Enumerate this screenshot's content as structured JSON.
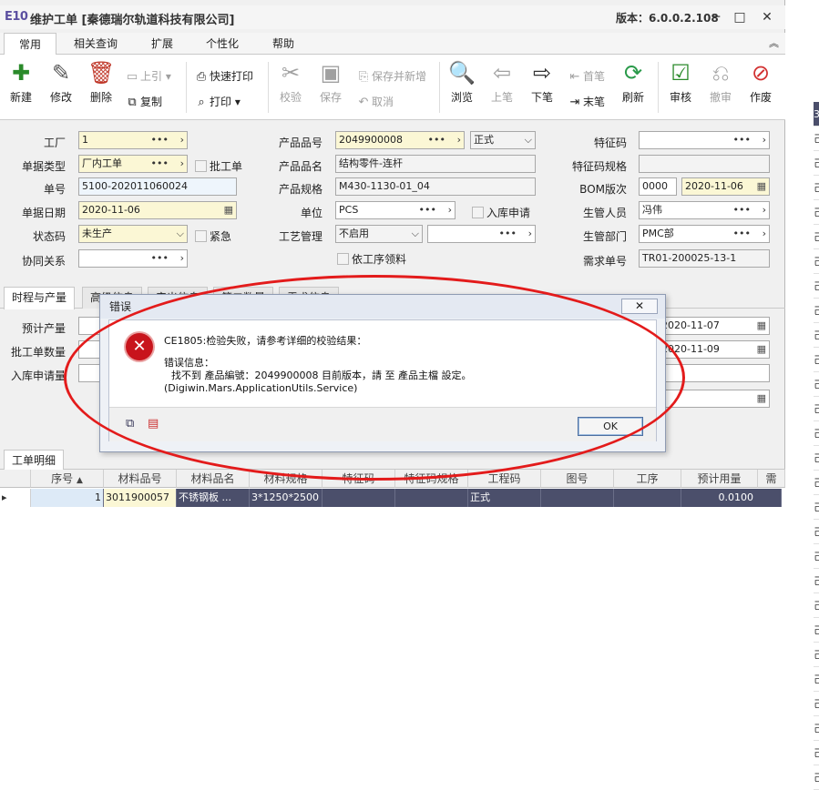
{
  "title": {
    "logo": "E10",
    "doc": "维护工单 [秦德瑞尔轨道科技有限公司]",
    "version": "版本：6.0.0.2.108"
  },
  "menu": [
    "常用",
    "相关查询",
    "扩展",
    "个性化",
    "帮助"
  ],
  "toolbar": {
    "new": "新建",
    "edit": "修改",
    "delete": "删除",
    "prev_rec": "上引",
    "copy": "复制",
    "quick_print": "快速打印",
    "print": "打印",
    "check": "校验",
    "save": "保存",
    "save_new": "保存并新增",
    "cancel": "取消",
    "browse": "浏览",
    "prev": "上笔",
    "next": "下笔",
    "first": "首笔",
    "last": "末笔",
    "refresh": "刷新",
    "audit": "审核",
    "unaudit": "撤审",
    "void": "作废"
  },
  "form": {
    "factory": {
      "label": "工厂",
      "value": "1"
    },
    "doc_type": {
      "label": "单据类型",
      "value": "厂内工单"
    },
    "batch": {
      "label": "批工单"
    },
    "doc_no": {
      "label": "单号",
      "value": "5100-202011060024"
    },
    "doc_date": {
      "label": "单据日期",
      "value": "2020-11-06"
    },
    "status": {
      "label": "状态码",
      "value": "未生产"
    },
    "urgent": {
      "label": "紧急"
    },
    "collab": {
      "label": "协同关系",
      "value": ""
    },
    "item_no": {
      "label": "产品品号",
      "value": "2049900008",
      "status": "正式"
    },
    "item_name": {
      "label": "产品品名",
      "value": "结构零件-连杆"
    },
    "item_spec": {
      "label": "产品规格",
      "value": "M430-1130-01_04"
    },
    "unit": {
      "label": "单位",
      "value": "PCS"
    },
    "stock_in_req": {
      "label": "入库申请"
    },
    "process_mgmt": {
      "label": "工艺管理",
      "value": "不启用"
    },
    "by_process": {
      "label": "依工序领料"
    },
    "feature_code": {
      "label": "特征码",
      "value": ""
    },
    "feature_spec": {
      "label": "特征码规格",
      "value": ""
    },
    "bom": {
      "label": "BOM版次",
      "value": "0000",
      "date": "2020-11-06"
    },
    "manager": {
      "label": "生管人员",
      "value": "冯伟"
    },
    "dept": {
      "label": "生管部门",
      "value": "PMC部"
    },
    "req_no": {
      "label": "需求单号",
      "value": "TR01-200025-13-1"
    }
  },
  "tabs1": [
    "时程与产量",
    "高级信息",
    "产出信息",
    "第二数量",
    "需求信息"
  ],
  "sec2": {
    "planned_output": "预计产量",
    "batch_qty": "批工单数量",
    "stock_req_qty": "入库申请量",
    "date1": "2020-11-07",
    "date2": "2020-11-09"
  },
  "tabs2": [
    "工单明细"
  ],
  "grid": {
    "headers": [
      "序号",
      "材料品号",
      "材料品名",
      "材料规格",
      "特征码",
      "特征码规格",
      "工程码",
      "图号",
      "工序",
      "预计用量",
      "需"
    ],
    "row": {
      "seq": "1",
      "item": "3011900057",
      "name": "不锈钢板 ...",
      "spec": "3*1250*2500",
      "feature": "",
      "feature_spec": "",
      "eng": "正式",
      "drawing": "",
      "process": "",
      "qty": "0.0100"
    }
  },
  "right_col": [
    "3",
    "己",
    "己",
    "己",
    "己",
    "己",
    "己",
    "己",
    "己",
    "己",
    "己",
    "己",
    "己",
    "己",
    "己",
    "己",
    "己",
    "己",
    "己",
    "己",
    "己",
    "己",
    "己",
    "己",
    "己",
    "己",
    "己",
    "己"
  ],
  "dialog": {
    "title": "错误",
    "line1": "CE1805:检验失败，请参考详细的校验结果：",
    "line2": "错误信息：",
    "line3": "找不到 產品編號：2049900008 目前版本，請 至 產品主檔 設定。",
    "line4": "(Digiwin.Mars.ApplicationUtils.Service)",
    "ok": "OK"
  },
  "colors": {
    "accent": "#5b4fa0",
    "highlight": "#e31b1b",
    "grid_row": "#4b4f6b"
  }
}
